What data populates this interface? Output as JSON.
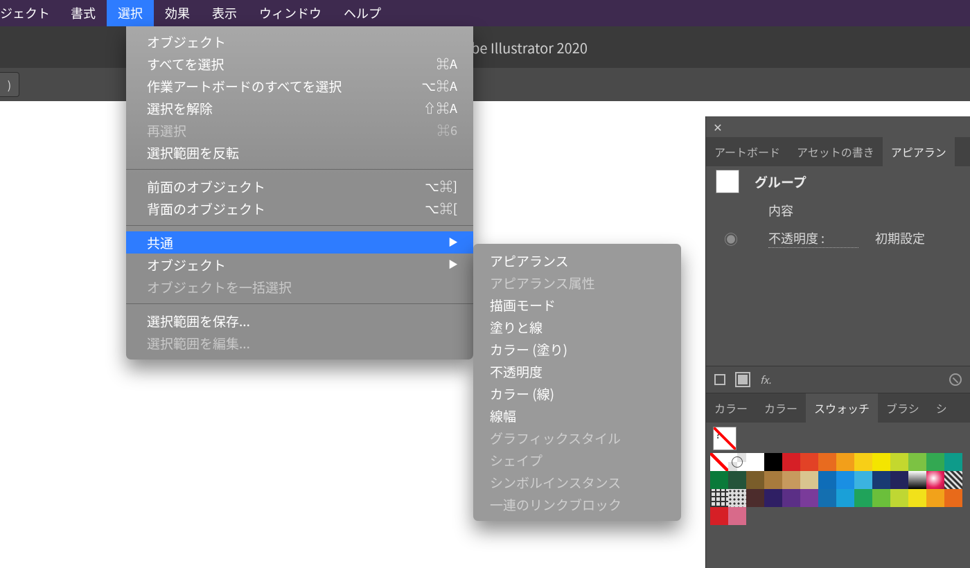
{
  "menubar": {
    "items": [
      "ジェクト",
      "書式",
      "選択",
      "効果",
      "表示",
      "ウィンドウ",
      "ヘルプ"
    ],
    "active_index": 2
  },
  "app_title": "be Illustrator 2020",
  "substrip_stub": ")",
  "dropdown": {
    "groups": [
      [
        {
          "label": "オブジェクト",
          "shortcut": "",
          "enabled": true,
          "submenu": false
        },
        {
          "label": "すべてを選択",
          "shortcut": "⌘A",
          "enabled": true,
          "submenu": false
        },
        {
          "label": "作業アートボードのすべてを選択",
          "shortcut": "⌥⌘A",
          "enabled": true,
          "submenu": false
        },
        {
          "label": "選択を解除",
          "shortcut": "⇧⌘A",
          "enabled": true,
          "submenu": false
        },
        {
          "label": "再選択",
          "shortcut": "⌘6",
          "enabled": false,
          "submenu": false
        },
        {
          "label": "選択範囲を反転",
          "shortcut": "",
          "enabled": true,
          "submenu": false
        }
      ],
      [
        {
          "label": "前面のオブジェクト",
          "shortcut": "⌥⌘]",
          "enabled": true,
          "submenu": false
        },
        {
          "label": "背面のオブジェクト",
          "shortcut": "⌥⌘[",
          "enabled": true,
          "submenu": false
        }
      ],
      [
        {
          "label": "共通",
          "shortcut": "",
          "enabled": true,
          "submenu": true,
          "highlight": true
        },
        {
          "label": "オブジェクト",
          "shortcut": "",
          "enabled": true,
          "submenu": true
        },
        {
          "label": "オブジェクトを一括選択",
          "shortcut": "",
          "enabled": false,
          "submenu": false
        }
      ],
      [
        {
          "label": "選択範囲を保存...",
          "shortcut": "",
          "enabled": true,
          "submenu": false
        },
        {
          "label": "選択範囲を編集...",
          "shortcut": "",
          "enabled": false,
          "submenu": false
        }
      ]
    ]
  },
  "submenu": {
    "items": [
      {
        "label": "アピアランス",
        "enabled": true
      },
      {
        "label": "アピアランス属性",
        "enabled": false
      },
      {
        "label": "描画モード",
        "enabled": true
      },
      {
        "label": "塗りと線",
        "enabled": true
      },
      {
        "label": "カラー (塗り)",
        "enabled": true
      },
      {
        "label": "不透明度",
        "enabled": true
      },
      {
        "label": "カラー (線)",
        "enabled": true
      },
      {
        "label": "線幅",
        "enabled": true
      },
      {
        "label": "グラフィックスタイル",
        "enabled": false
      },
      {
        "label": "シェイプ",
        "enabled": false
      },
      {
        "label": "シンボルインスタンス",
        "enabled": false
      },
      {
        "label": "一連のリンクブロック",
        "enabled": false
      }
    ]
  },
  "panel": {
    "tabs_top": [
      "アートボード",
      "アセットの書き",
      "アピアラン"
    ],
    "tabs_top_active": 2,
    "group_label": "グループ",
    "content_label": "内容",
    "opacity_label": "不透明度 :",
    "opacity_value": "初期設定",
    "fx_label": "fx.",
    "tabs_bottom": [
      "カラー",
      "カラー",
      "スウォッチ",
      "ブラシ",
      "シ"
    ],
    "tabs_bottom_active": 2,
    "none_swatch_label": "?",
    "swatch_colors": [
      "none",
      "reg",
      "#ffffff",
      "#000000",
      "#d61f26",
      "#e24226",
      "#e86b1f",
      "#f29f1a",
      "#f7cf17",
      "#f4e500",
      "#c4d82e",
      "#7cc243",
      "#33a852",
      "#0e9b8a",
      "#0a7a3a",
      "#24543a",
      "#7a5d2a",
      "#a87b3d",
      "#c79a5e",
      "#d9c58f",
      "#0f6db8",
      "#1a8fe3",
      "#3bb3e0",
      "#193a73",
      "#23245c",
      "grad",
      "radial",
      "hatch",
      "cross",
      "dots",
      "#4c2c2c",
      "#2f1f64",
      "#5b2f86",
      "#7a3b9a",
      "#146fb0",
      "#1aa0d8",
      "#20a35a",
      "#6bbf3b",
      "#bfd733",
      "#f2e11a",
      "#f2a21a",
      "#e86a1a",
      "#d61f26",
      "#d86a8a"
    ]
  }
}
